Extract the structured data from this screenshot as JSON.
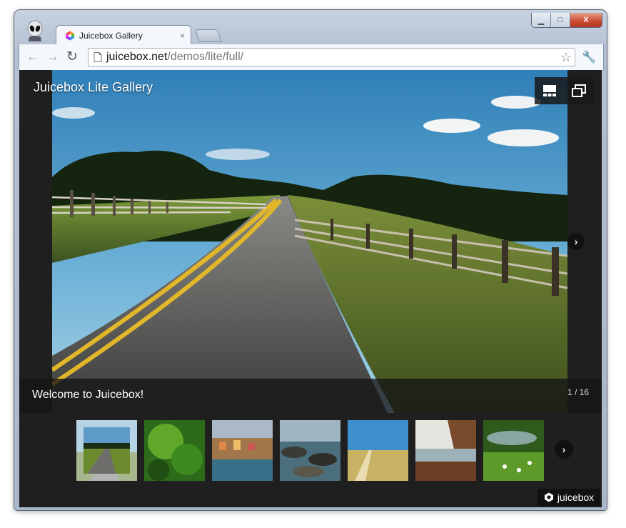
{
  "browser": {
    "tab_title": "Juicebox Gallery",
    "tab_close": "×",
    "url_host": "juicebox.net",
    "url_path": "/demos/lite/full/",
    "window_controls": {
      "minimize": "▁",
      "maximize": "□",
      "close": "X"
    }
  },
  "gallery": {
    "title": "Juicebox Lite Gallery",
    "caption": "Welcome to Juicebox!",
    "counter": "1 / 16",
    "brand": "juicebox",
    "thumbnails": [
      {
        "name": "road"
      },
      {
        "name": "green-leaves"
      },
      {
        "name": "coastal-village"
      },
      {
        "name": "river-rocks"
      },
      {
        "name": "wheat-field"
      },
      {
        "name": "beach-cliffs"
      },
      {
        "name": "meadow-stream"
      }
    ]
  },
  "icons": {
    "back": "back-arrow-icon",
    "forward": "forward-arrow-icon",
    "reload": "reload-icon",
    "bookmark": "star-icon",
    "settings": "wrench-icon",
    "thumbnails_toggle": "thumbnails-icon",
    "fullscreen": "expand-icon",
    "next": "next-arrow-icon"
  }
}
